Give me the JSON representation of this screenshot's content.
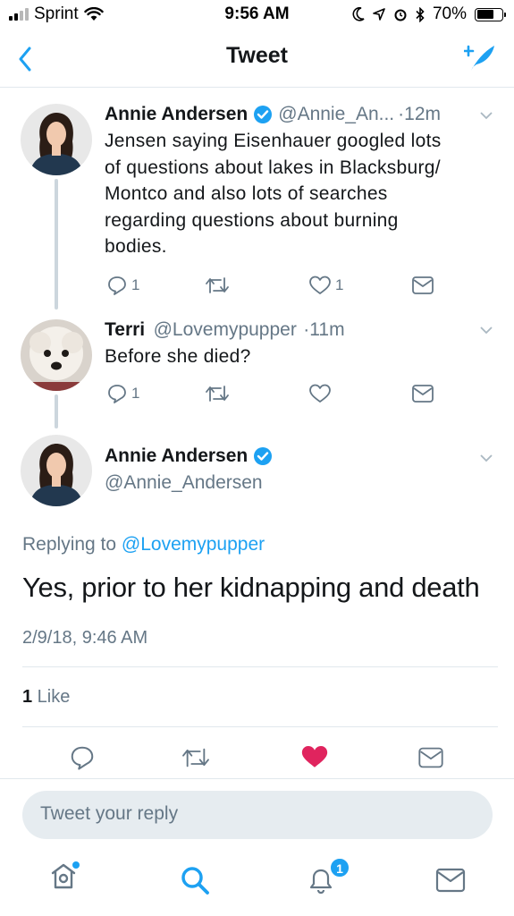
{
  "status_bar": {
    "carrier": "Sprint",
    "time": "9:56 AM",
    "battery": "70%"
  },
  "nav": {
    "title": "Tweet"
  },
  "tweets": [
    {
      "name": "Annie Andersen",
      "handle": "@Annie_An...",
      "time": "·12m",
      "text_lines": [
        "Jensen saying Eisenhauer googled lots",
        "of questions about lakes in Blacksburg/",
        "Montco and also lots of searches",
        "regarding questions about burning",
        "bodies."
      ],
      "reply_count": "1",
      "like_count": "1"
    },
    {
      "name": "Terri",
      "handle": "@Lovemypupper",
      "time": "·11m",
      "text": "Before she died?",
      "reply_count": "1"
    }
  ],
  "main_tweet": {
    "name": "Annie Andersen",
    "handle": "@Annie_Andersen",
    "replying_label": "Replying to ",
    "replying_handle": "@Lovemypupper",
    "text": "Yes, prior to her kidnapping and death",
    "timestamp": "2/9/18, 9:46 AM",
    "like_count": "1",
    "like_label": " Like"
  },
  "reply_box": {
    "placeholder": "Tweet your reply"
  },
  "tab_bar": {
    "notifications_badge": "1"
  },
  "colors": {
    "accent": "#1da1f2",
    "verified": "#1da1f2",
    "liked": "#e0245e",
    "secondary": "#657786"
  },
  "icons": [
    "back-arrow-icon",
    "compose-icon",
    "verified-icon",
    "reply-icon",
    "retweet-icon",
    "heart-icon",
    "mail-icon",
    "chevron-down-icon",
    "home-icon",
    "search-icon",
    "bell-icon"
  ]
}
